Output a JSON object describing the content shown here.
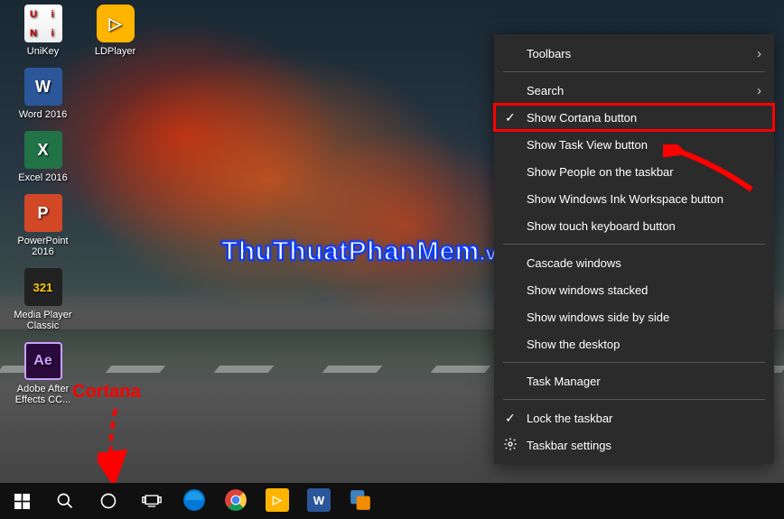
{
  "desktop_icons": {
    "unikey": "UniKey",
    "ldplayer": "LDPlayer",
    "word": "Word 2016",
    "excel": "Excel 2016",
    "powerpoint": "PowerPoint 2016",
    "mpc": "Media Player Classic",
    "ae": "Adobe After Effects CC..."
  },
  "icon_glyphs": {
    "word": "W",
    "excel": "X",
    "ppt": "P",
    "mpc": "321",
    "ae": "Ae",
    "ld": "▷"
  },
  "watermark": {
    "main": "ThuThuatPhanMem",
    "suffix": ".vn"
  },
  "annotation": {
    "cortana": "Cortana"
  },
  "context_menu": {
    "toolbars": "Toolbars",
    "search": "Search",
    "show_cortana": "Show Cortana button",
    "show_taskview": "Show Task View button",
    "show_people": "Show People on the taskbar",
    "show_ink": "Show Windows Ink Workspace button",
    "show_touch_kb": "Show touch keyboard button",
    "cascade": "Cascade windows",
    "stacked": "Show windows stacked",
    "sidebyside": "Show windows side by side",
    "show_desktop": "Show the desktop",
    "task_manager": "Task Manager",
    "lock_taskbar": "Lock the taskbar",
    "taskbar_settings": "Taskbar settings"
  },
  "colors": {
    "highlight": "#ff0000",
    "menu_bg": "#2b2b2b"
  }
}
